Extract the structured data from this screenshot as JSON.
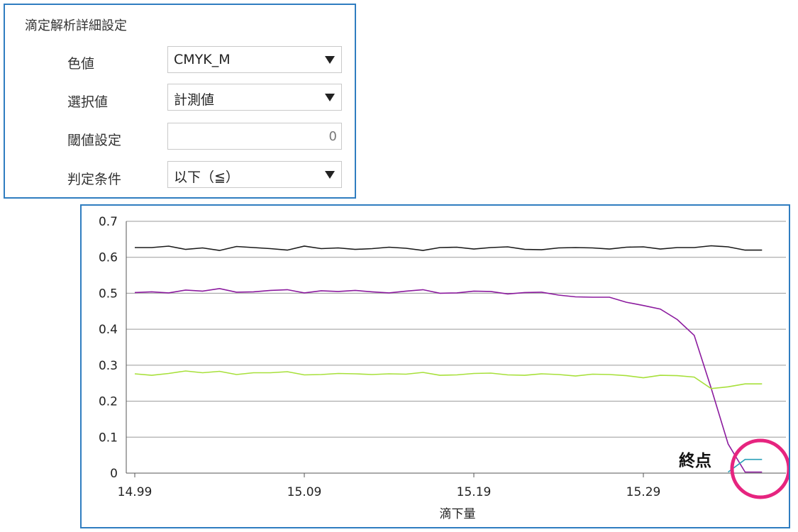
{
  "settings_panel": {
    "title": "滴定解析詳細設定",
    "color_value": {
      "label": "色値",
      "selected": "CMYK_M"
    },
    "selection_value": {
      "label": "選択値",
      "selected": "計測値"
    },
    "threshold": {
      "label": "閾値設定",
      "value": "0"
    },
    "condition": {
      "label": "判定条件",
      "selected": "以下（≦）"
    }
  },
  "annotation": {
    "endpoint_label": "終点",
    "highlight_color": "#e6247f"
  },
  "chart_data": {
    "type": "line",
    "xlabel": "滴下量",
    "ylabel": "",
    "xlim": [
      14.99,
      15.35
    ],
    "ylim": [
      0,
      0.7
    ],
    "x_ticks": [
      "14.99",
      "15.09",
      "15.19",
      "15.29"
    ],
    "y_ticks": [
      "0",
      "0.1",
      "0.2",
      "0.3",
      "0.4",
      "0.5",
      "0.6",
      "0.7"
    ],
    "grid": "horizontal",
    "x": [
      14.99,
      15.0,
      15.01,
      15.02,
      15.03,
      15.04,
      15.05,
      15.06,
      15.07,
      15.08,
      15.09,
      15.1,
      15.11,
      15.12,
      15.13,
      15.14,
      15.15,
      15.16,
      15.17,
      15.18,
      15.19,
      15.2,
      15.21,
      15.22,
      15.23,
      15.24,
      15.25,
      15.26,
      15.27,
      15.28,
      15.29,
      15.3,
      15.31,
      15.32,
      15.33,
      15.34,
      15.35,
      15.36
    ],
    "series": [
      {
        "color": "#1a1a1a",
        "values": [
          0.627,
          0.627,
          0.631,
          0.622,
          0.626,
          0.619,
          0.63,
          0.627,
          0.624,
          0.62,
          0.631,
          0.624,
          0.626,
          0.622,
          0.624,
          0.628,
          0.625,
          0.619,
          0.627,
          0.628,
          0.623,
          0.627,
          0.629,
          0.622,
          0.621,
          0.626,
          0.627,
          0.626,
          0.623,
          0.628,
          0.629,
          0.623,
          0.627,
          0.627,
          0.632,
          0.629,
          0.62,
          0.62
        ]
      },
      {
        "color": "#8b1a9e",
        "values": [
          0.502,
          0.504,
          0.501,
          0.509,
          0.506,
          0.513,
          0.503,
          0.504,
          0.508,
          0.51,
          0.501,
          0.507,
          0.505,
          0.508,
          0.504,
          0.501,
          0.506,
          0.51,
          0.5,
          0.501,
          0.506,
          0.505,
          0.498,
          0.502,
          0.503,
          0.495,
          0.49,
          0.489,
          0.489,
          0.475,
          0.466,
          0.456,
          0.427,
          0.383,
          0.236,
          0.081,
          0.003,
          0.003
        ]
      },
      {
        "color": "#a7e03a",
        "values": [
          0.276,
          0.272,
          0.277,
          0.284,
          0.279,
          0.283,
          0.274,
          0.279,
          0.279,
          0.282,
          0.273,
          0.274,
          0.277,
          0.276,
          0.274,
          0.276,
          0.275,
          0.28,
          0.272,
          0.273,
          0.277,
          0.278,
          0.273,
          0.272,
          0.276,
          0.274,
          0.27,
          0.275,
          0.274,
          0.271,
          0.265,
          0.272,
          0.271,
          0.267,
          0.235,
          0.24,
          0.248,
          0.248
        ]
      },
      {
        "color": "#2a9fb8",
        "values": [
          null,
          null,
          null,
          null,
          null,
          null,
          null,
          null,
          null,
          null,
          null,
          null,
          null,
          null,
          null,
          null,
          null,
          null,
          null,
          null,
          null,
          null,
          null,
          null,
          null,
          null,
          null,
          null,
          null,
          null,
          null,
          null,
          null,
          null,
          null,
          0.003,
          0.038,
          0.038
        ]
      }
    ]
  }
}
